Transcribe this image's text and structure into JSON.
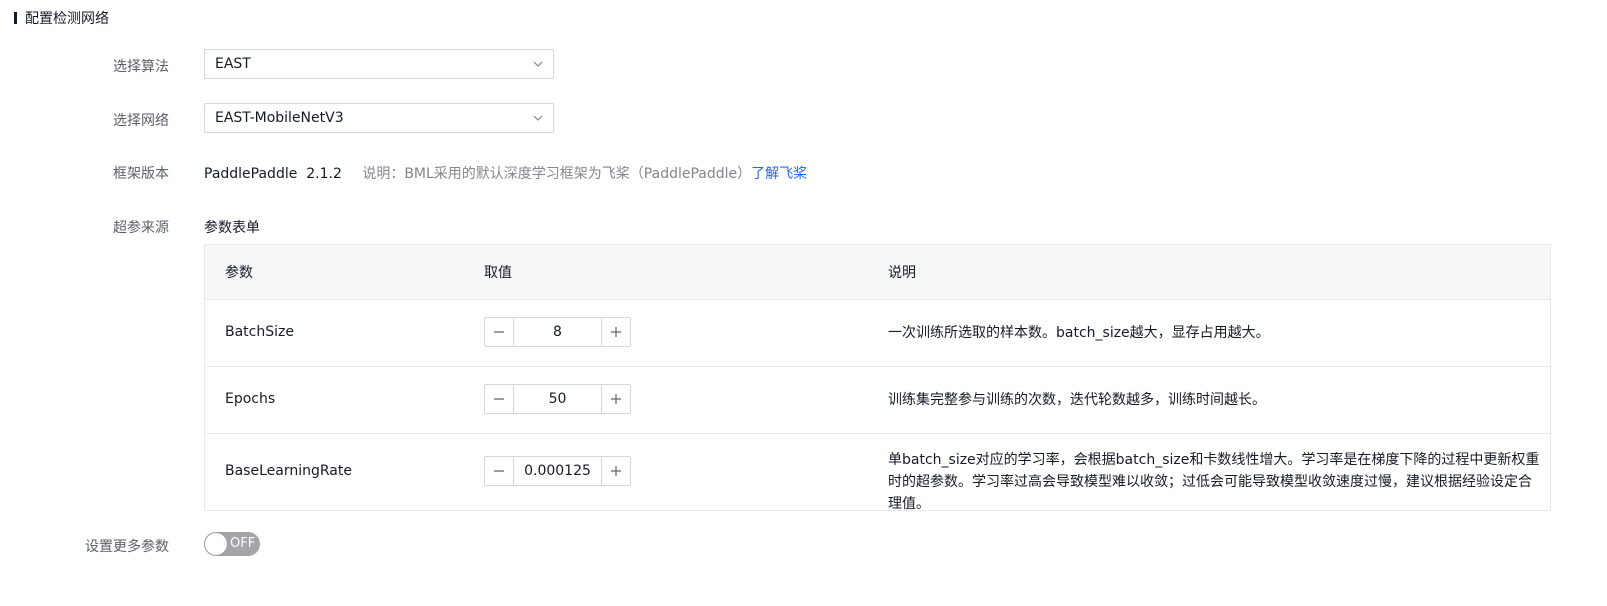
{
  "section_title": "配置检测网络",
  "form": {
    "algorithm": {
      "label": "选择算法",
      "value": "EAST"
    },
    "network": {
      "label": "选择网络",
      "value": "EAST-MobileNetV3"
    },
    "framework": {
      "label": "框架版本",
      "value": "PaddlePaddle  2.1.2",
      "note": "说明：BML采用的默认深度学习框架为飞桨（PaddlePaddle）",
      "link": "了解飞桨"
    },
    "hyperparam": {
      "label": "超参来源",
      "value": "参数表单"
    },
    "more_params": {
      "label": "设置更多参数",
      "toggle_text": "OFF"
    }
  },
  "table": {
    "headers": [
      "参数",
      "取值",
      "说明"
    ],
    "rows": [
      {
        "name": "BatchSize",
        "value": "8",
        "desc": "一次训练所选取的样本数。batch_size越大，显存占用越大。"
      },
      {
        "name": "Epochs",
        "value": "50",
        "desc": "训练集完整参与训练的次数，迭代轮数越多，训练时间越长。"
      },
      {
        "name": "BaseLearningRate",
        "value": "0.000125",
        "desc": "单batch_size对应的学习率，会根据batch_size和卡数线性增大。学习率是在梯度下降的过程中更新权重时的超参数。学习率过高会导致模型难以收敛；过低会可能导致模型收敛速度过慢，建议根据经验设定合理值。"
      }
    ]
  },
  "colors": {
    "link": "#2468f2",
    "toggle_off": "#a3a5a8",
    "header_bg": "#f7f7f9"
  }
}
